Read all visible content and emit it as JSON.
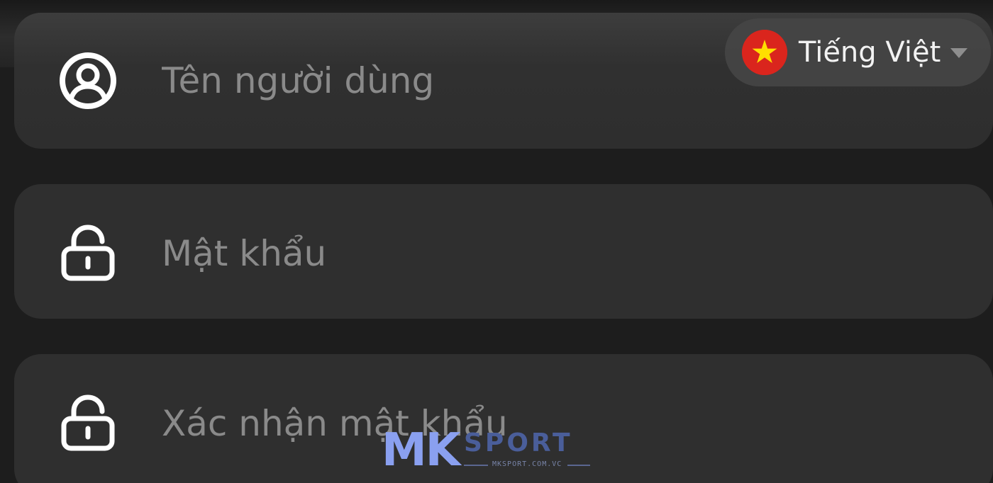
{
  "form": {
    "username": {
      "placeholder": "Tên người dùng",
      "value": "",
      "icon": "user-circle-icon"
    },
    "password": {
      "placeholder": "Mật khẩu",
      "value": "",
      "icon": "lock-icon"
    },
    "confirm_password": {
      "placeholder": "Xác nhận mật khẩu",
      "value": "",
      "icon": "lock-icon"
    }
  },
  "language_selector": {
    "label": "Tiếng Việt",
    "flag_icon": "vietnam-flag-icon",
    "caret_icon": "chevron-down-icon"
  },
  "watermark": {
    "logo_mk": "MK",
    "logo_sport": "SPORT",
    "site": "MKSPORT.COM.VC"
  },
  "colors": {
    "background": "#1d1d1d",
    "field_background": "#2f2f2f",
    "placeholder": "#8a8a8a",
    "flag_red": "#da251d",
    "flag_star": "#ffde00",
    "logo_blue": "#8aa0f0"
  }
}
